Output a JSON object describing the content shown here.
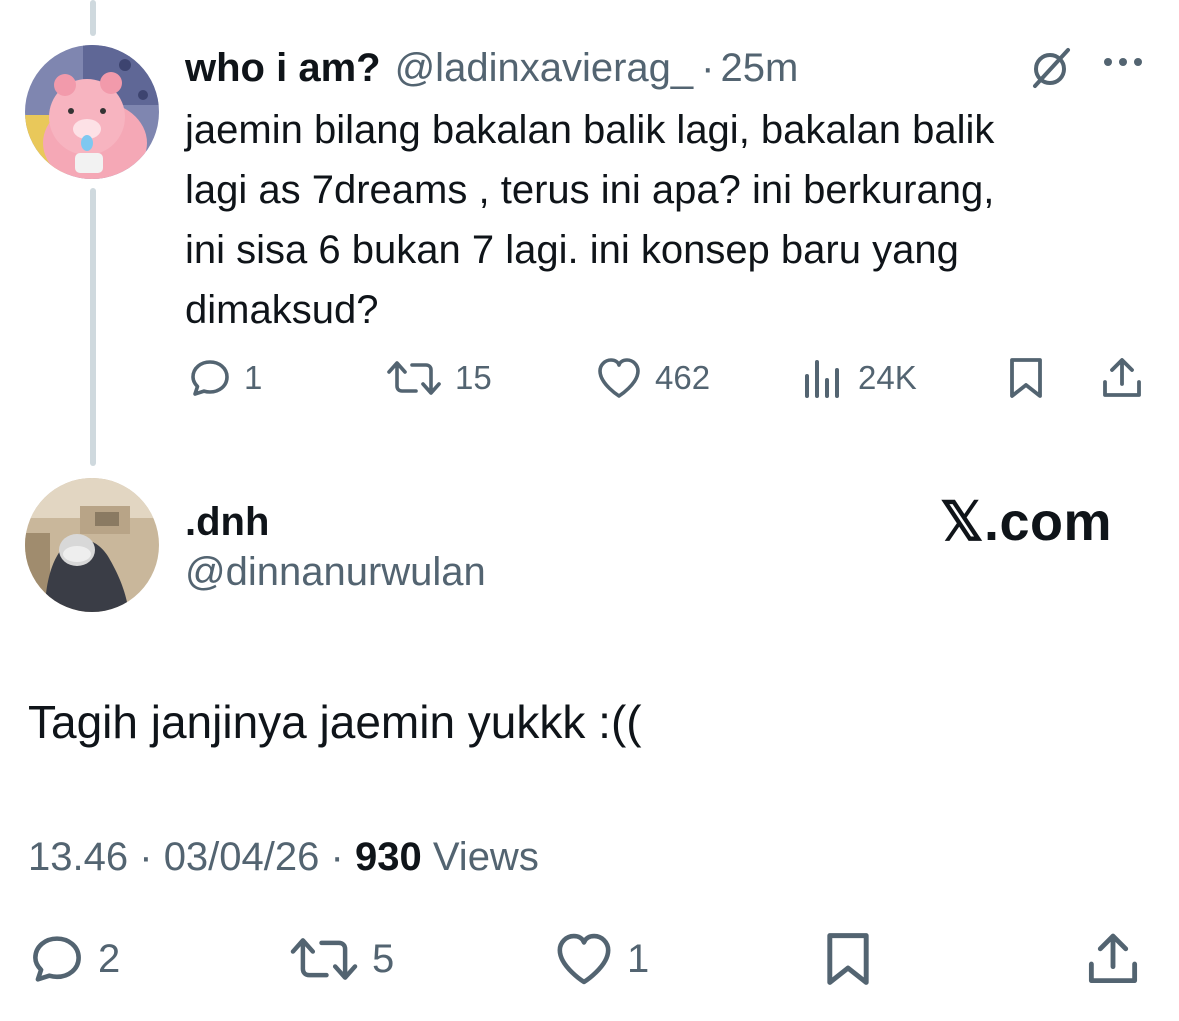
{
  "parent_tweet": {
    "display_name": "who i am?",
    "handle": "@ladinxavierag_",
    "separator": "·",
    "time": "25m",
    "text": "jaemin bilang bakalan balik lagi, bakalan balik\nlagi as 7dreams , terus ini apa? ini berkurang,\nini sisa 6 bukan 7 lagi. ini konsep baru yang\ndimaksud?",
    "stats": {
      "replies": "1",
      "reposts": "15",
      "likes": "462",
      "views": "24K"
    },
    "icons": [
      "circle-slash-icon",
      "more-icon",
      "reply-icon",
      "repost-icon",
      "like-icon",
      "views-icon",
      "bookmark-icon",
      "share-icon"
    ]
  },
  "quote_tweet": {
    "display_name": ".dnh",
    "handle": "@dinnanurwulan",
    "brand": "𝕏.com",
    "text": "Tagih janjinya jaemin yukkk :((",
    "meta": {
      "time": "13.46",
      "sep1": "·",
      "date": "03/04/26",
      "sep2": "·",
      "views": "930",
      "views_label": "Views"
    },
    "stats": {
      "replies": "2",
      "reposts": "5",
      "likes": "1"
    }
  },
  "colors": {
    "text": "#0f1419",
    "secondary": "#536471",
    "thread_line": "#cfd9de",
    "background": "#ffffff"
  }
}
